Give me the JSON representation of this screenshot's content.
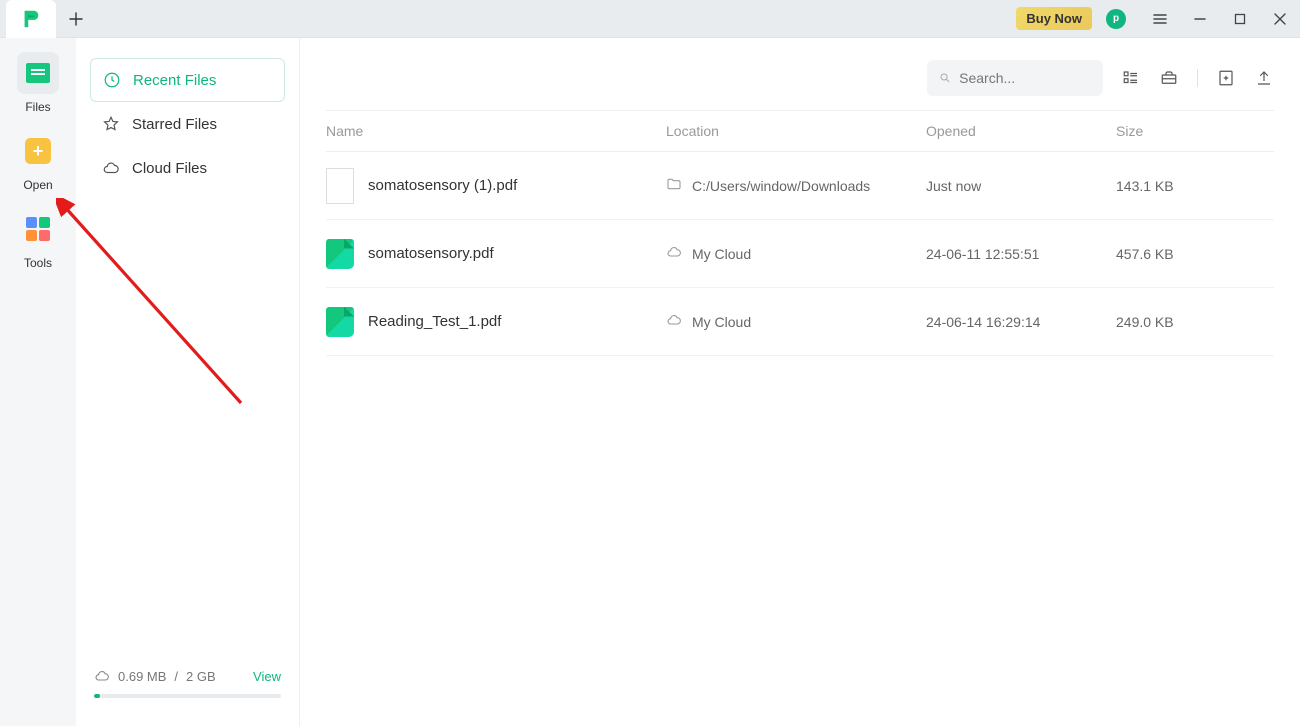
{
  "titlebar": {
    "buy_label": "Buy Now",
    "avatar_letter": "p"
  },
  "rail": {
    "files": "Files",
    "open": "Open",
    "tools": "Tools"
  },
  "sidebar": {
    "recent": "Recent Files",
    "starred": "Starred Files",
    "cloud": "Cloud Files",
    "storage_used": "0.69 MB",
    "storage_sep": "/",
    "storage_cap": "2 GB",
    "view": "View"
  },
  "toolbar": {
    "search_placeholder": "Search..."
  },
  "columns": {
    "name": "Name",
    "location": "Location",
    "opened": "Opened",
    "size": "Size"
  },
  "rows": [
    {
      "name": "somatosensory (1).pdf",
      "icon": "doc",
      "location": "C:/Users/window/Downloads",
      "loc_icon": "folder",
      "opened": "Just now",
      "size": "143.1 KB"
    },
    {
      "name": "somatosensory.pdf",
      "icon": "pdf",
      "location": "My Cloud",
      "loc_icon": "cloud",
      "opened": "24-06-11 12:55:51",
      "size": "457.6 KB"
    },
    {
      "name": "Reading_Test_1.pdf",
      "icon": "pdf",
      "location": "My Cloud",
      "loc_icon": "cloud",
      "opened": "24-06-14 16:29:14",
      "size": "249.0 KB"
    }
  ]
}
